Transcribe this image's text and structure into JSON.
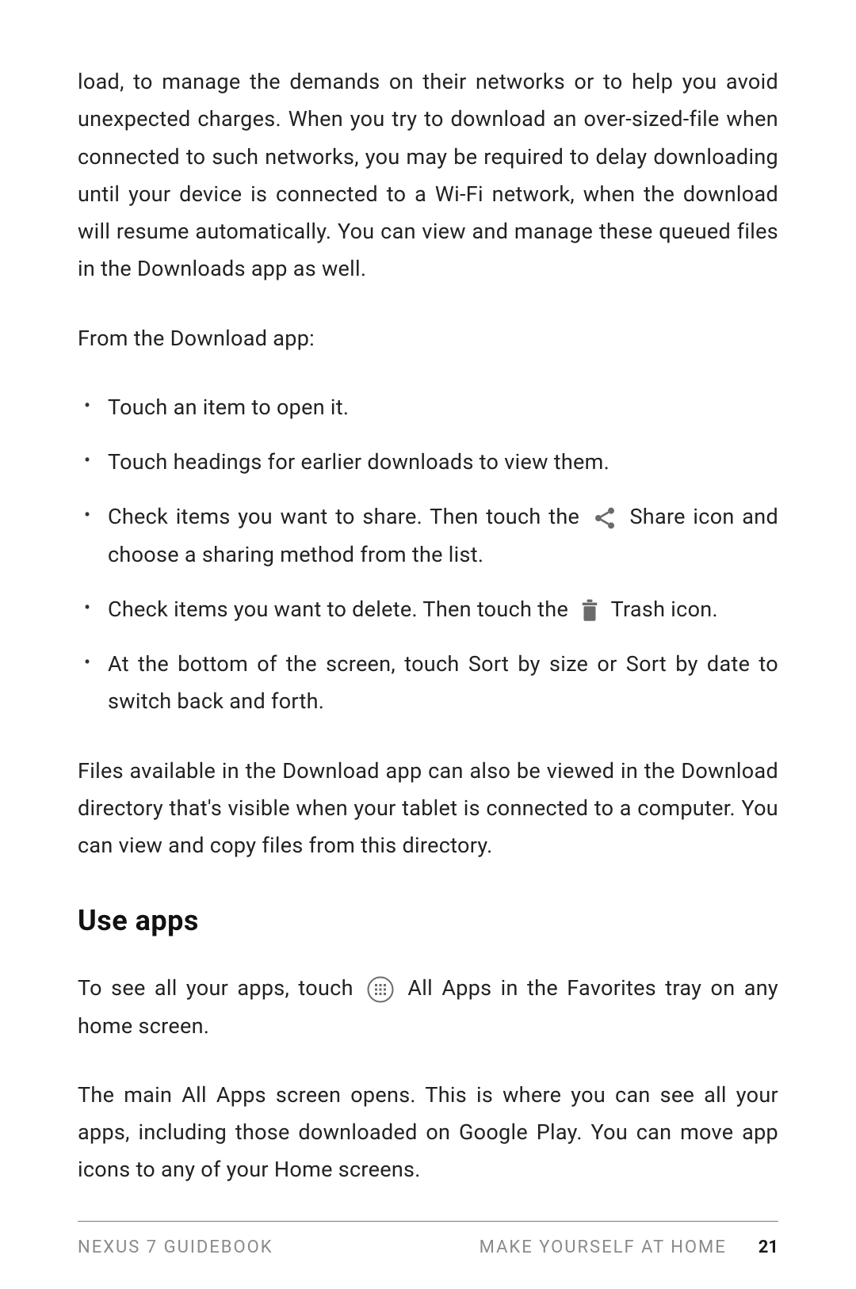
{
  "body": {
    "para1": "load, to manage the demands on their networks or to help you avoid unexpected charges. When you try to download an over-sized-file when connected to such networks, you may be required to delay downloading until your device is connected to a Wi-Fi network, when the download will resume automatically. You can view and manage these queued files in the Downloads app as well.",
    "para2": "From the Download app:",
    "bullets": [
      {
        "text": "Touch an item to open it."
      },
      {
        "text": "Touch headings for earlier downloads to view them."
      },
      {
        "before": "Check items you want to share. Then touch the ",
        "icon": "share",
        "after": " Share icon and choose a sharing method from the list."
      },
      {
        "before": "Check items you want to delete. Then touch the ",
        "icon": "trash",
        "after": " Trash icon."
      },
      {
        "text": "At the bottom of the screen, touch Sort by size or Sort by date to switch back and forth."
      }
    ],
    "para3": "Files available in the Download app can also be viewed in the Download directory that's visible when your tablet is connected to a computer. You can view and copy files from this directory.",
    "heading": "Use apps",
    "para4_before": "To see all your apps, touch ",
    "para4_after": " All Apps in the Favorites tray on any home screen.",
    "para5": "The main All Apps screen opens. This is where you can see all your apps, including those downloaded on Google Play. You can move app icons to any of your Home screens."
  },
  "footer": {
    "left": "NEXUS 7 GUIDEBOOK",
    "right": "MAKE YOURSELF AT HOME",
    "page": "21"
  }
}
